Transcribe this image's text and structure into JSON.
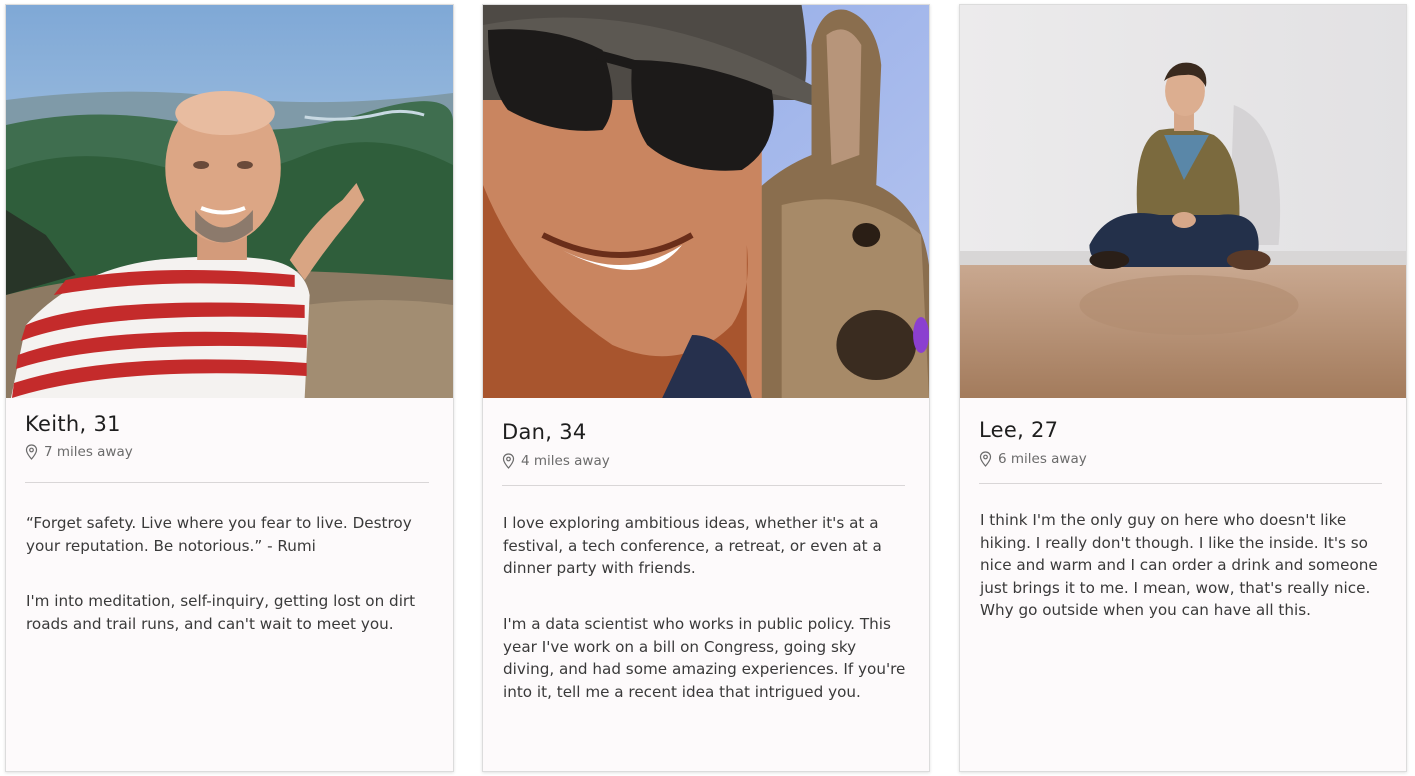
{
  "profiles": [
    {
      "name_age": "Keith, 31",
      "distance": "7 miles away",
      "bio": [
        "“Forget safety. Live where you fear to live. Destroy your reputation. Be notorious.” - Rumi",
        "I'm into meditation, self-inquiry, getting lost on dirt roads and trail runs, and can't wait to meet you."
      ]
    },
    {
      "name_age": "Dan, 34",
      "distance": "4 miles away",
      "bio": [
        "I love exploring ambitious ideas, whether it's at a festival, a tech conference, a retreat, or even at a dinner party with friends.",
        "I'm a data scientist who works in public policy. This year I've work on a bill on Congress, going sky diving, and had some amazing experiences. If you're into it, tell me a recent idea that intrigued you."
      ]
    },
    {
      "name_age": "Lee, 27",
      "distance": "6 miles away",
      "bio": [
        "I think I'm the only guy on here who doesn't like hiking. I really don't though. I like the inside. It's so nice and warm and I can order a drink and someone just brings it to me. I mean, wow, that's really nice. Why go outside when you can have all this."
      ]
    }
  ],
  "icons": {
    "location": "location-pin-icon"
  },
  "colors": {
    "card_background": "#fdfafb",
    "divider": "#d9d6d7",
    "secondary_text": "#6b6b6b"
  }
}
